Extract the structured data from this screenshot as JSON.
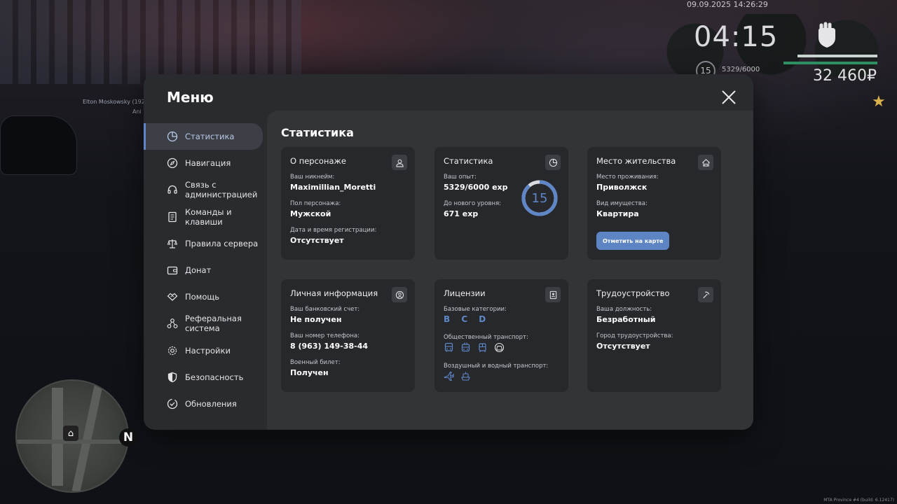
{
  "hud": {
    "datetime": "09.09.2025 14:26:29",
    "time": "04:15",
    "level": "15",
    "exp": "5329/6000",
    "money": "32 460₽",
    "build": "MTA Province #4 (build: 6.12417)"
  },
  "world": {
    "player_tag_line1": "Elton Moskowsky (192",
    "player_tag_line2": "Ani",
    "compass": "N"
  },
  "menu": {
    "title": "Меню",
    "nav": [
      {
        "label": "Статистика",
        "icon": "stats-icon"
      },
      {
        "label": "Навигация",
        "icon": "compass-icon"
      },
      {
        "label": "Связь с администрацией",
        "icon": "headset-icon"
      },
      {
        "label": "Команды и клавиши",
        "icon": "document-icon"
      },
      {
        "label": "Правила сервера",
        "icon": "scales-icon"
      },
      {
        "label": "Донат",
        "icon": "wallet-icon"
      },
      {
        "label": "Помощь",
        "icon": "handshake-icon"
      },
      {
        "label": "Реферальная система",
        "icon": "referral-icon"
      },
      {
        "label": "Настройки",
        "icon": "gear-icon"
      },
      {
        "label": "Безопасность",
        "icon": "shield-icon"
      },
      {
        "label": "Обновления",
        "icon": "check-circle-icon"
      }
    ]
  },
  "content": {
    "title": "Статистика",
    "character": {
      "title": "О персонаже",
      "nickname_label": "Ваш никнейм:",
      "nickname": "Maximillian_Moretti",
      "gender_label": "Пол персонажа:",
      "gender": "Мужской",
      "reg_label": "Дата и время регистрации:",
      "reg": "Отсутствует"
    },
    "stats": {
      "title": "Статистика",
      "exp_label": "Ваш опыт:",
      "exp": "5329/6000 exp",
      "next_label": "До нового уровня:",
      "next": "671 exp",
      "level": "15",
      "progress": 0.888
    },
    "residence": {
      "title": "Место жительства",
      "place_label": "Место проживания:",
      "place": "Приволжск",
      "type_label": "Вид имущества:",
      "type": "Квартира",
      "map_button": "Отметить на карте"
    },
    "personal": {
      "title": "Личная информация",
      "bank_label": "Ваш банковский счет:",
      "bank": "Не получен",
      "phone_label": "Ваш номер телефона:",
      "phone": "8 (963) 149-38-44",
      "military_label": "Военный билет:",
      "military": "Получен"
    },
    "licenses": {
      "title": "Лицензии",
      "base_label": "Базовые категории:",
      "base": "B C D",
      "public_label": "Общественный транспорт:",
      "air_label": "Воздушный и водный транспорт:"
    },
    "employment": {
      "title": "Трудоустройство",
      "position_label": "Ваша должность:",
      "position": "Безработный",
      "city_label": "Город трудоустройства:",
      "city": "Отсутствует"
    }
  },
  "colors": {
    "accent": "#5f87c8",
    "card": "#27282c",
    "panel": "#333438",
    "window": "#2a2b2f"
  }
}
